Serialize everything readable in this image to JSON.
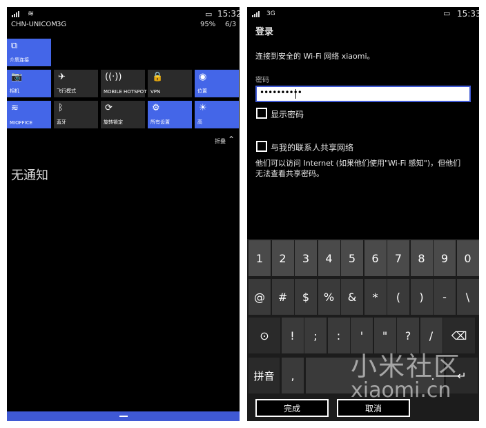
{
  "left_screen": {
    "status": {
      "time": "15:32",
      "carrier": "CHN-UNICOM",
      "network": "3G",
      "battery": "95%",
      "date": "6/3"
    },
    "top_tile": {
      "label": "介质连接",
      "icon": "media-connect-icon"
    },
    "tiles_row1": [
      {
        "label": "相机",
        "icon": "camera-icon",
        "glyph": "📷"
      },
      {
        "label": "飞行模式",
        "icon": "airplane-icon",
        "glyph": "✈"
      },
      {
        "label": "MOBILE HOTSPOT",
        "icon": "hotspot-icon",
        "glyph": "((·))"
      },
      {
        "label": "VPN",
        "icon": "lock-icon",
        "glyph": "🔒"
      },
      {
        "label": "位置",
        "icon": "location-icon",
        "glyph": "◉"
      }
    ],
    "tiles_row2": [
      {
        "label": "MIOFFICE",
        "icon": "wifi-icon",
        "glyph": "≋"
      },
      {
        "label": "蓝牙",
        "icon": "bluetooth-icon",
        "glyph": "ᛒ"
      },
      {
        "label": "旋转锁定",
        "icon": "rotation-lock-icon",
        "glyph": "⟳"
      },
      {
        "label": "所有设置",
        "icon": "settings-icon",
        "glyph": "⚙"
      },
      {
        "label": "高",
        "icon": "brightness-icon",
        "glyph": "☀"
      }
    ],
    "collapse_label": "折叠",
    "no_notifications": "无通知"
  },
  "right_screen": {
    "status": {
      "time": "15:33",
      "network": "3G"
    },
    "title": "登录",
    "connect_text": "连接到安全的 Wi-Fi 网络 xiaomi。",
    "password_label": "密码",
    "password_value": "••••••••••",
    "show_password": "显示密码",
    "share_label": "与我的联系人共享网络",
    "share_desc_line1": "他们可以访问 Internet (如果他们使用\"Wi-Fi 感知\")，但他们",
    "share_desc_line2": "无法查看共享密码。",
    "keyboard": {
      "row1": [
        "1",
        "2",
        "3",
        "4",
        "5",
        "6",
        "7",
        "8",
        "9",
        "0"
      ],
      "row2": [
        "@",
        "#",
        "$",
        "%",
        "&",
        "*",
        "(",
        ")",
        "-",
        "\\"
      ],
      "row3": [
        "⊙",
        "!",
        ";",
        ":",
        "'",
        "\"",
        "?",
        "/",
        "⌫"
      ],
      "pinyin": "拼音",
      "comma": ",",
      "period": ".",
      "enter": "↵"
    },
    "done_button": "完成",
    "cancel_button": "取消",
    "watermark_line1": "小米社区",
    "watermark_line2": "xiaomi.cn"
  }
}
